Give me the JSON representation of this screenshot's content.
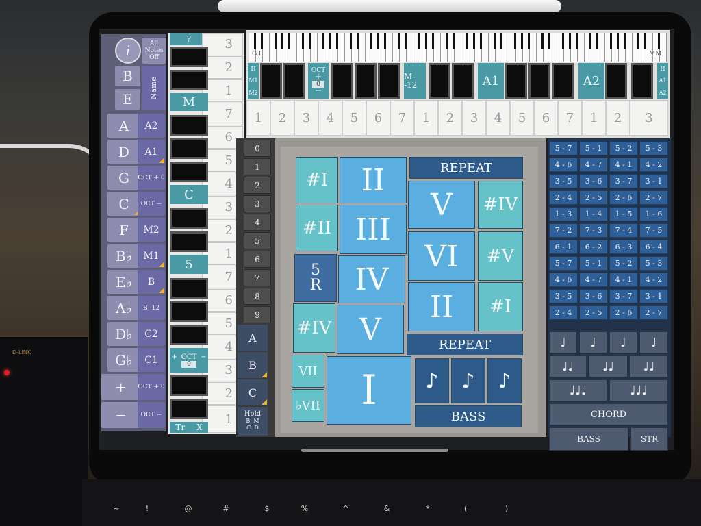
{
  "photo": {
    "router_logo": "D-LINK"
  },
  "left_panel": {
    "info_icon": "i",
    "all_notes_off": "All Notes Off",
    "name_label": "Name",
    "note_buttons": [
      "B",
      "E",
      "A",
      "D",
      "G",
      "C",
      "F",
      "B♭",
      "E♭",
      "A♭",
      "D♭",
      "G♭",
      "+",
      "−"
    ],
    "mode_buttons": [
      "A2",
      "A1",
      "OCT + 0",
      "OCT −",
      "M2",
      "M1",
      "B",
      "B -12",
      "C2",
      "C1",
      "OCT + 0",
      "OCT −"
    ]
  },
  "vertical_keyboard": {
    "top_label": "?",
    "numbers": [
      "3",
      "2",
      "1",
      "7",
      "6",
      "5",
      "4",
      "3",
      "2",
      "1",
      "7",
      "6",
      "5",
      "4",
      "3",
      "2",
      "1"
    ],
    "teal_labels": [
      "M",
      "C",
      "5"
    ],
    "oct_label": "OCT",
    "oct_value": "0",
    "oct_plus": "+",
    "oct_minus": "−",
    "bottom_left": "Tr",
    "bottom_right": "X"
  },
  "top_keyboard": {
    "left_marker": "G.L",
    "right_marker": "MM",
    "left_side": [
      "H",
      "M1",
      "M2"
    ],
    "right_side": [
      "H",
      "A1",
      "A2"
    ],
    "oct_label": "OCT",
    "oct_plus": "+",
    "oct_value": "0",
    "oct_minus": "−",
    "teal_labels": [
      "M -12",
      "A1",
      "A2"
    ],
    "numbers": [
      "1",
      "2",
      "3",
      "4",
      "5",
      "6",
      "7",
      "1",
      "2",
      "3",
      "4",
      "5",
      "6",
      "7",
      "1",
      "2",
      "3"
    ]
  },
  "number_column": {
    "values": [
      "0",
      "1",
      "2",
      "3",
      "4",
      "5",
      "6",
      "7",
      "8",
      "9"
    ],
    "letters": [
      "A",
      "B",
      "C"
    ],
    "hold": "Hold",
    "hold_sub": [
      "B",
      "M",
      "C",
      "D"
    ]
  },
  "chord_pad": {
    "repeat_top": "REPEAT",
    "repeat_mid": "REPEAT",
    "bass": "BASS",
    "sharp_one": "#I",
    "sharp_two": "#II",
    "five_r": "5",
    "five_r_sub": "R",
    "sharp_four": "#IV",
    "vii": "VII",
    "flat_vii": "♭VII",
    "ii": "II",
    "iii": "III",
    "iv": "IV",
    "v_lower": "V",
    "i": "I",
    "v": "V",
    "sharp_iv_right": "#IV",
    "vi": "VI",
    "sharp_v": "#V",
    "ii_right": "II",
    "sharp_i_right": "#I",
    "note_glyph": "♪"
  },
  "interval_grid": [
    [
      "5 - 7",
      "5 - 1",
      "5 - 2",
      "5 - 3"
    ],
    [
      "4 - 6",
      "4 - 7",
      "4 - 1",
      "4 - 2"
    ],
    [
      "3 - 5",
      "3 - 6",
      "3 - 7",
      "3 - 1"
    ],
    [
      "2 - 4",
      "2 - 5",
      "2 - 6",
      "2 - 7"
    ],
    [
      "1 - 3",
      "1 - 4",
      "1 - 5",
      "1 - 6"
    ],
    [
      "7 - 2",
      "7 - 3",
      "7 - 4",
      "7 - 5"
    ],
    [
      "6 - 1",
      "6 - 2",
      "6 - 3",
      "6 - 4"
    ],
    [
      "5 - 7",
      "5 - 1",
      "5 - 2",
      "5 - 3"
    ],
    [
      "4 - 6",
      "4 - 7",
      "4 - 1",
      "4 - 2"
    ],
    [
      "3 - 5",
      "3 - 6",
      "3 - 7",
      "3 - 1"
    ],
    [
      "2 - 4",
      "2 - 5",
      "2 - 6",
      "2 - 7"
    ]
  ],
  "rhythm": {
    "quarter": "♩",
    "pair": "♩♩",
    "triple": "♩♩♩",
    "chord": "CHORD",
    "bass": "BASS",
    "str": "STR"
  },
  "external_keyboard": [
    "~",
    "!",
    "@",
    "#",
    "$",
    "%",
    "^",
    "&",
    "*",
    "(",
    ")"
  ]
}
